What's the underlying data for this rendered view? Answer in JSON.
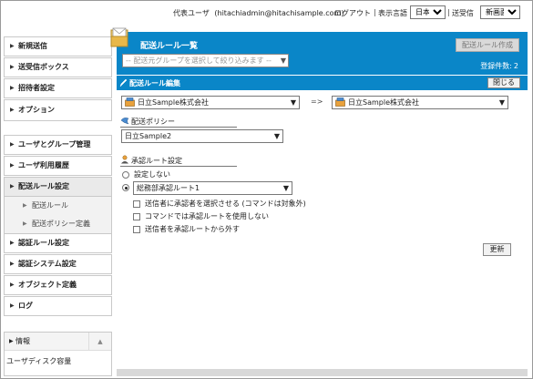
{
  "header": {
    "user_name": "代表ユーザ",
    "user_email": "(hitachiadmin@hitachisample.com)",
    "logout": "ログアウト",
    "separator": "|",
    "language_label": "表示言語",
    "language_value": "日本語",
    "send_receive_label": "送受信",
    "send_receive_value": "新画面"
  },
  "sidebar": {
    "items": [
      {
        "label": "新規送信"
      },
      {
        "label": "送受信ボックス"
      },
      {
        "label": "招待者設定"
      },
      {
        "label": "オプション"
      },
      {
        "label": "ユーザとグループ管理"
      },
      {
        "label": "ユーザ利用履歴"
      },
      {
        "label": "配送ルール設定"
      },
      {
        "label": "認証ルール設定"
      },
      {
        "label": "認証システム設定"
      },
      {
        "label": "オブジェクト定義"
      },
      {
        "label": "ログ"
      }
    ],
    "sub_items": [
      {
        "label": "配送ルール"
      },
      {
        "label": "配送ポリシー定義"
      }
    ],
    "info": {
      "title": "情報",
      "body": "ユーザディスク容量"
    }
  },
  "main": {
    "title": "配送ルール一覧",
    "create_button": "配送ルール作成",
    "filter_placeholder": "-- 配送元グループを選択して絞り込みます --",
    "count_label": "登録件数:",
    "count_value": "2",
    "edit": {
      "title": "配送ルール編集",
      "close_button": "閉じる",
      "source_company": "日立Sample株式会社",
      "arrow": "=>",
      "dest_company": "日立Sample株式会社",
      "policy_label": "配送ポリシー",
      "policy_value": "日立Sample2",
      "approval_label": "承認ルート設定",
      "option_none": "設定しない",
      "option_route": "総務部承認ルート1",
      "checkbox_1": "送信者に承認者を選択させる (コマンドは対象外)",
      "checkbox_2": "コマンドでは承認ルートを使用しない",
      "checkbox_3": "送信者を承認ルートから外す",
      "update_button": "更新"
    }
  },
  "colors": {
    "accent_blue": "#0a86c8",
    "border_gray": "#c9c9c9"
  },
  "icons": [
    "envelope-folder-icon",
    "pencil-icon",
    "org-icon",
    "policy-icon",
    "approver-icon",
    "chevron-right-icon",
    "chevron-down-icon"
  ]
}
